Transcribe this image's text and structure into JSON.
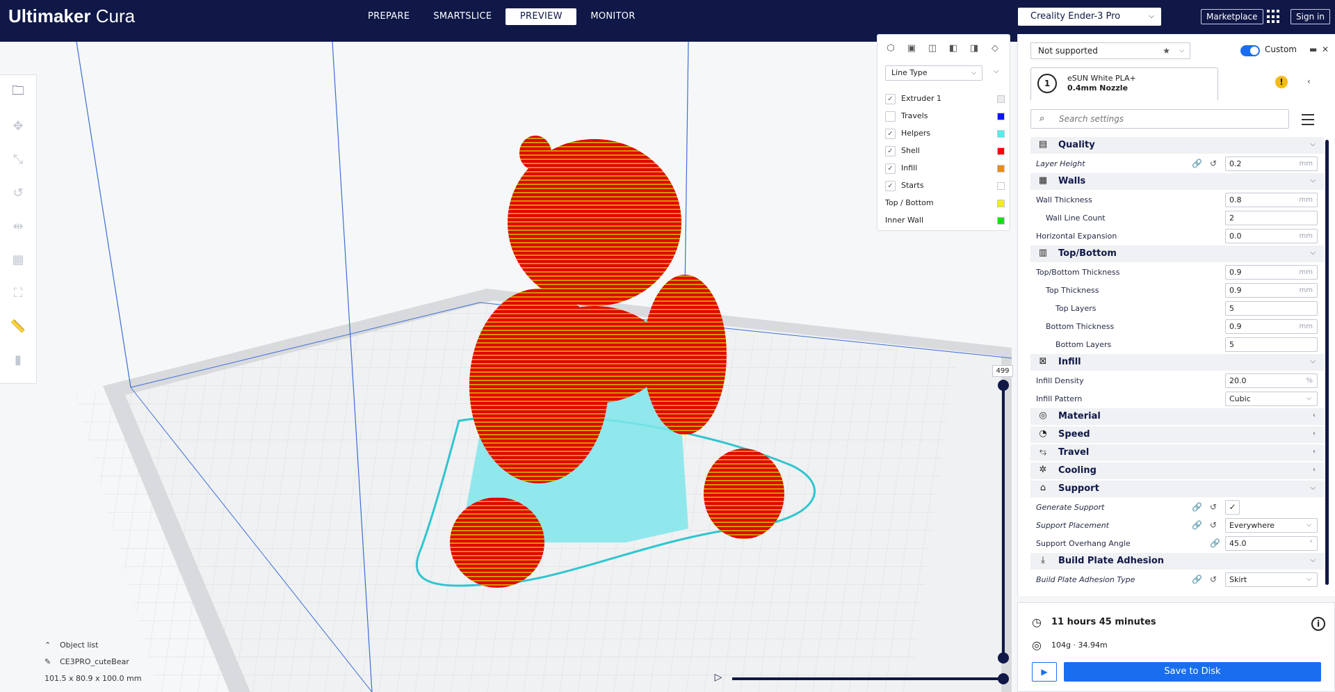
{
  "header": {
    "logo_bold": "Ultimaker",
    "logo_light": " Cura",
    "tabs": [
      {
        "label": "PREPARE"
      },
      {
        "label": "SMARTSLICE"
      },
      {
        "label": "PREVIEW",
        "active": true
      },
      {
        "label": "MONITOR"
      }
    ],
    "printer": "Creality Ender-3 Pro",
    "marketplace": "Marketplace",
    "signin": "Sign in"
  },
  "view_panel": {
    "line_type": "Line Type",
    "legend": [
      {
        "label": "Extruder 1",
        "checked": true,
        "color": "#ececec"
      },
      {
        "label": "Travels",
        "checked": false,
        "color": "#0a14ff"
      },
      {
        "label": "Helpers",
        "checked": true,
        "color": "#55ecec"
      },
      {
        "label": "Shell",
        "checked": true,
        "color": "#ff0000"
      },
      {
        "label": "Infill",
        "checked": true,
        "color": "#f08a0e"
      },
      {
        "label": "Starts",
        "checked": true,
        "color": "#ffffff"
      },
      {
        "label": "Top / Bottom",
        "checked": null,
        "color": "#f2ec18"
      },
      {
        "label": "Inner Wall",
        "checked": null,
        "color": "#14e214"
      }
    ]
  },
  "layer": {
    "current": "499"
  },
  "object_info": {
    "list_label": "Object list",
    "object_name": "CE3PRO_cuteBear",
    "dimensions": "101.5 x 80.9 x 100.0 mm"
  },
  "settings": {
    "profile": "Not supported",
    "custom_label": "Custom",
    "extruder_number": "1",
    "material": "eSUN White PLA+",
    "nozzle": "0.4mm Nozzle",
    "search_placeholder": "Search settings",
    "rows": [
      {
        "kind": "cat",
        "label": "Quality",
        "icon": "quality-icon",
        "glyph": "▤",
        "chev": "⌵"
      },
      {
        "kind": "set",
        "label": "Layer Height",
        "italic": true,
        "indent": 0,
        "value": "0.2",
        "unit": "mm",
        "link": true,
        "reset": true
      },
      {
        "kind": "cat",
        "label": "Walls",
        "icon": "walls-icon",
        "glyph": "▦",
        "chev": "⌵"
      },
      {
        "kind": "set",
        "label": "Wall Thickness",
        "indent": 0,
        "value": "0.8",
        "unit": "mm"
      },
      {
        "kind": "set",
        "label": "Wall Line Count",
        "indent": 1,
        "value": "2",
        "unit": ""
      },
      {
        "kind": "set",
        "label": "Horizontal Expansion",
        "indent": 0,
        "value": "0.0",
        "unit": "mm"
      },
      {
        "kind": "cat",
        "label": "Top/Bottom",
        "icon": "top-bottom-icon",
        "glyph": "▥",
        "chev": "⌵"
      },
      {
        "kind": "set",
        "label": "Top/Bottom Thickness",
        "indent": 0,
        "value": "0.9",
        "unit": "mm"
      },
      {
        "kind": "set",
        "label": "Top Thickness",
        "indent": 1,
        "value": "0.9",
        "unit": "mm"
      },
      {
        "kind": "set",
        "label": "Top Layers",
        "indent": 2,
        "value": "5",
        "unit": ""
      },
      {
        "kind": "set",
        "label": "Bottom Thickness",
        "indent": 1,
        "value": "0.9",
        "unit": "mm"
      },
      {
        "kind": "set",
        "label": "Bottom Layers",
        "indent": 2,
        "value": "5",
        "unit": ""
      },
      {
        "kind": "cat",
        "label": "Infill",
        "icon": "infill-icon",
        "glyph": "⊠",
        "chev": "⌵"
      },
      {
        "kind": "set",
        "label": "Infill Density",
        "indent": 0,
        "value": "20.0",
        "unit": "%"
      },
      {
        "kind": "set",
        "label": "Infill Pattern",
        "indent": 0,
        "value": "Cubic",
        "select": true
      },
      {
        "kind": "cat",
        "label": "Material",
        "icon": "material-icon",
        "glyph": "◎",
        "chev": "‹"
      },
      {
        "kind": "cat",
        "label": "Speed",
        "icon": "speed-icon",
        "glyph": "◔",
        "chev": "‹"
      },
      {
        "kind": "cat",
        "label": "Travel",
        "icon": "travel-icon",
        "glyph": "⥃",
        "chev": "‹"
      },
      {
        "kind": "cat",
        "label": "Cooling",
        "icon": "cooling-icon",
        "glyph": "✲",
        "chev": "‹"
      },
      {
        "kind": "cat",
        "label": "Support",
        "icon": "support-icon",
        "glyph": "⌂",
        "chev": "⌵"
      },
      {
        "kind": "set",
        "label": "Generate Support",
        "italic": true,
        "indent": 0,
        "check": true,
        "link": true,
        "reset": true
      },
      {
        "kind": "set",
        "label": "Support Placement",
        "italic": true,
        "indent": 0,
        "value": "Everywhere",
        "select": true,
        "link": true,
        "reset": true
      },
      {
        "kind": "set",
        "label": "Support Overhang Angle",
        "indent": 0,
        "value": "45.0",
        "unit": "°",
        "link2": true
      },
      {
        "kind": "cat",
        "label": "Build Plate Adhesion",
        "icon": "adhesion-icon",
        "glyph": "⤓",
        "chev": "⌵"
      },
      {
        "kind": "set",
        "label": "Build Plate Adhesion Type",
        "italic": true,
        "indent": 0,
        "value": "Skirt",
        "select": true,
        "link": true,
        "reset": true
      }
    ]
  },
  "action": {
    "time": "11 hours 45 minutes",
    "material_usage": "104g · 34.94m",
    "save": "Save to Disk"
  }
}
